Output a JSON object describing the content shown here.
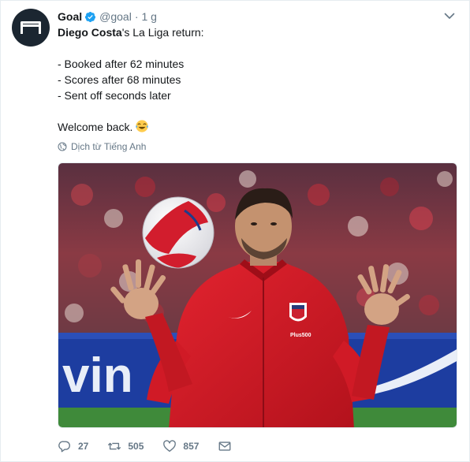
{
  "account": {
    "name": "Goal",
    "handle": "@goal",
    "separator": "·",
    "time": "1 g",
    "verified": true,
    "avatar_icon": "goal-logo-icon"
  },
  "tweet": {
    "lead_bold": "Diego Costa",
    "lead_rest": "'s La Liga return:",
    "bullets": [
      "- Booked after 62 minutes",
      "- Scores after 68 minutes",
      "- Sent off seconds later"
    ],
    "closing": "Welcome back.",
    "emoji": "laughing-tears-emoji"
  },
  "translate": {
    "label": "Dịch từ Tiếng Anh",
    "icon": "globe-icon"
  },
  "media": {
    "image": "photo-diego-costa-red-atletico-jacket-ball",
    "jersey_badge_text": "Plus500",
    "ad_text": "vin"
  },
  "actions": {
    "replies": "27",
    "retweets": "505",
    "likes": "857"
  },
  "colors": {
    "text": "#14171a",
    "muted": "#657786",
    "verified": "#1da1f2",
    "border": "#e6ecf0"
  }
}
